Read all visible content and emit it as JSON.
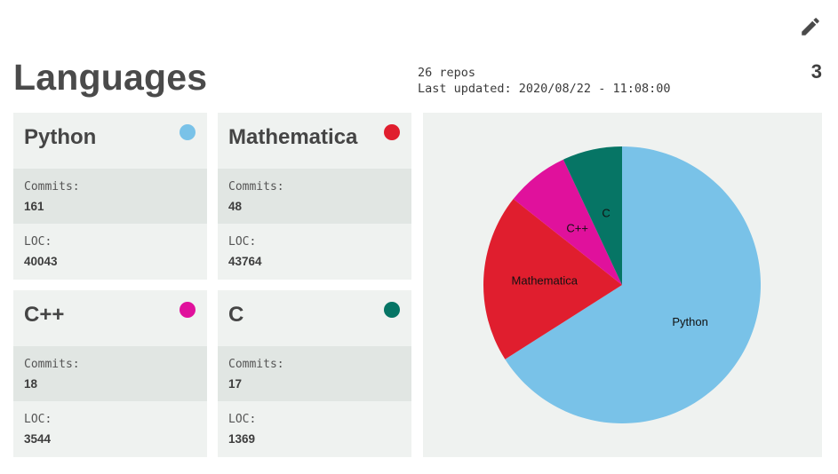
{
  "header": {
    "title": "Languages",
    "repos": "26 repos",
    "last_updated": "Last updated: 2020/08/22 - 11:08:00",
    "count": "3"
  },
  "toolbar": {
    "edit_icon": "pencil-icon"
  },
  "labels": {
    "commits": "Commits:",
    "loc": "LOC:"
  },
  "languages": [
    {
      "name": "Python",
      "color": "#79c2e8",
      "commits": "161",
      "loc": "40043"
    },
    {
      "name": "Mathematica",
      "color": "#e01e2e",
      "commits": "48",
      "loc": "43764"
    },
    {
      "name": "C++",
      "color": "#e0119c",
      "commits": "18",
      "loc": "3544"
    },
    {
      "name": "C",
      "color": "#067565",
      "commits": "17",
      "loc": "1369"
    }
  ],
  "chart_data": {
    "type": "pie",
    "categories": [
      "Python",
      "Mathematica",
      "C++",
      "C"
    ],
    "values": [
      161,
      48,
      18,
      17
    ],
    "colors": [
      "#79c2e8",
      "#e01e2e",
      "#e0119c",
      "#067565"
    ],
    "labels_on_slices": true,
    "legend": "none"
  }
}
